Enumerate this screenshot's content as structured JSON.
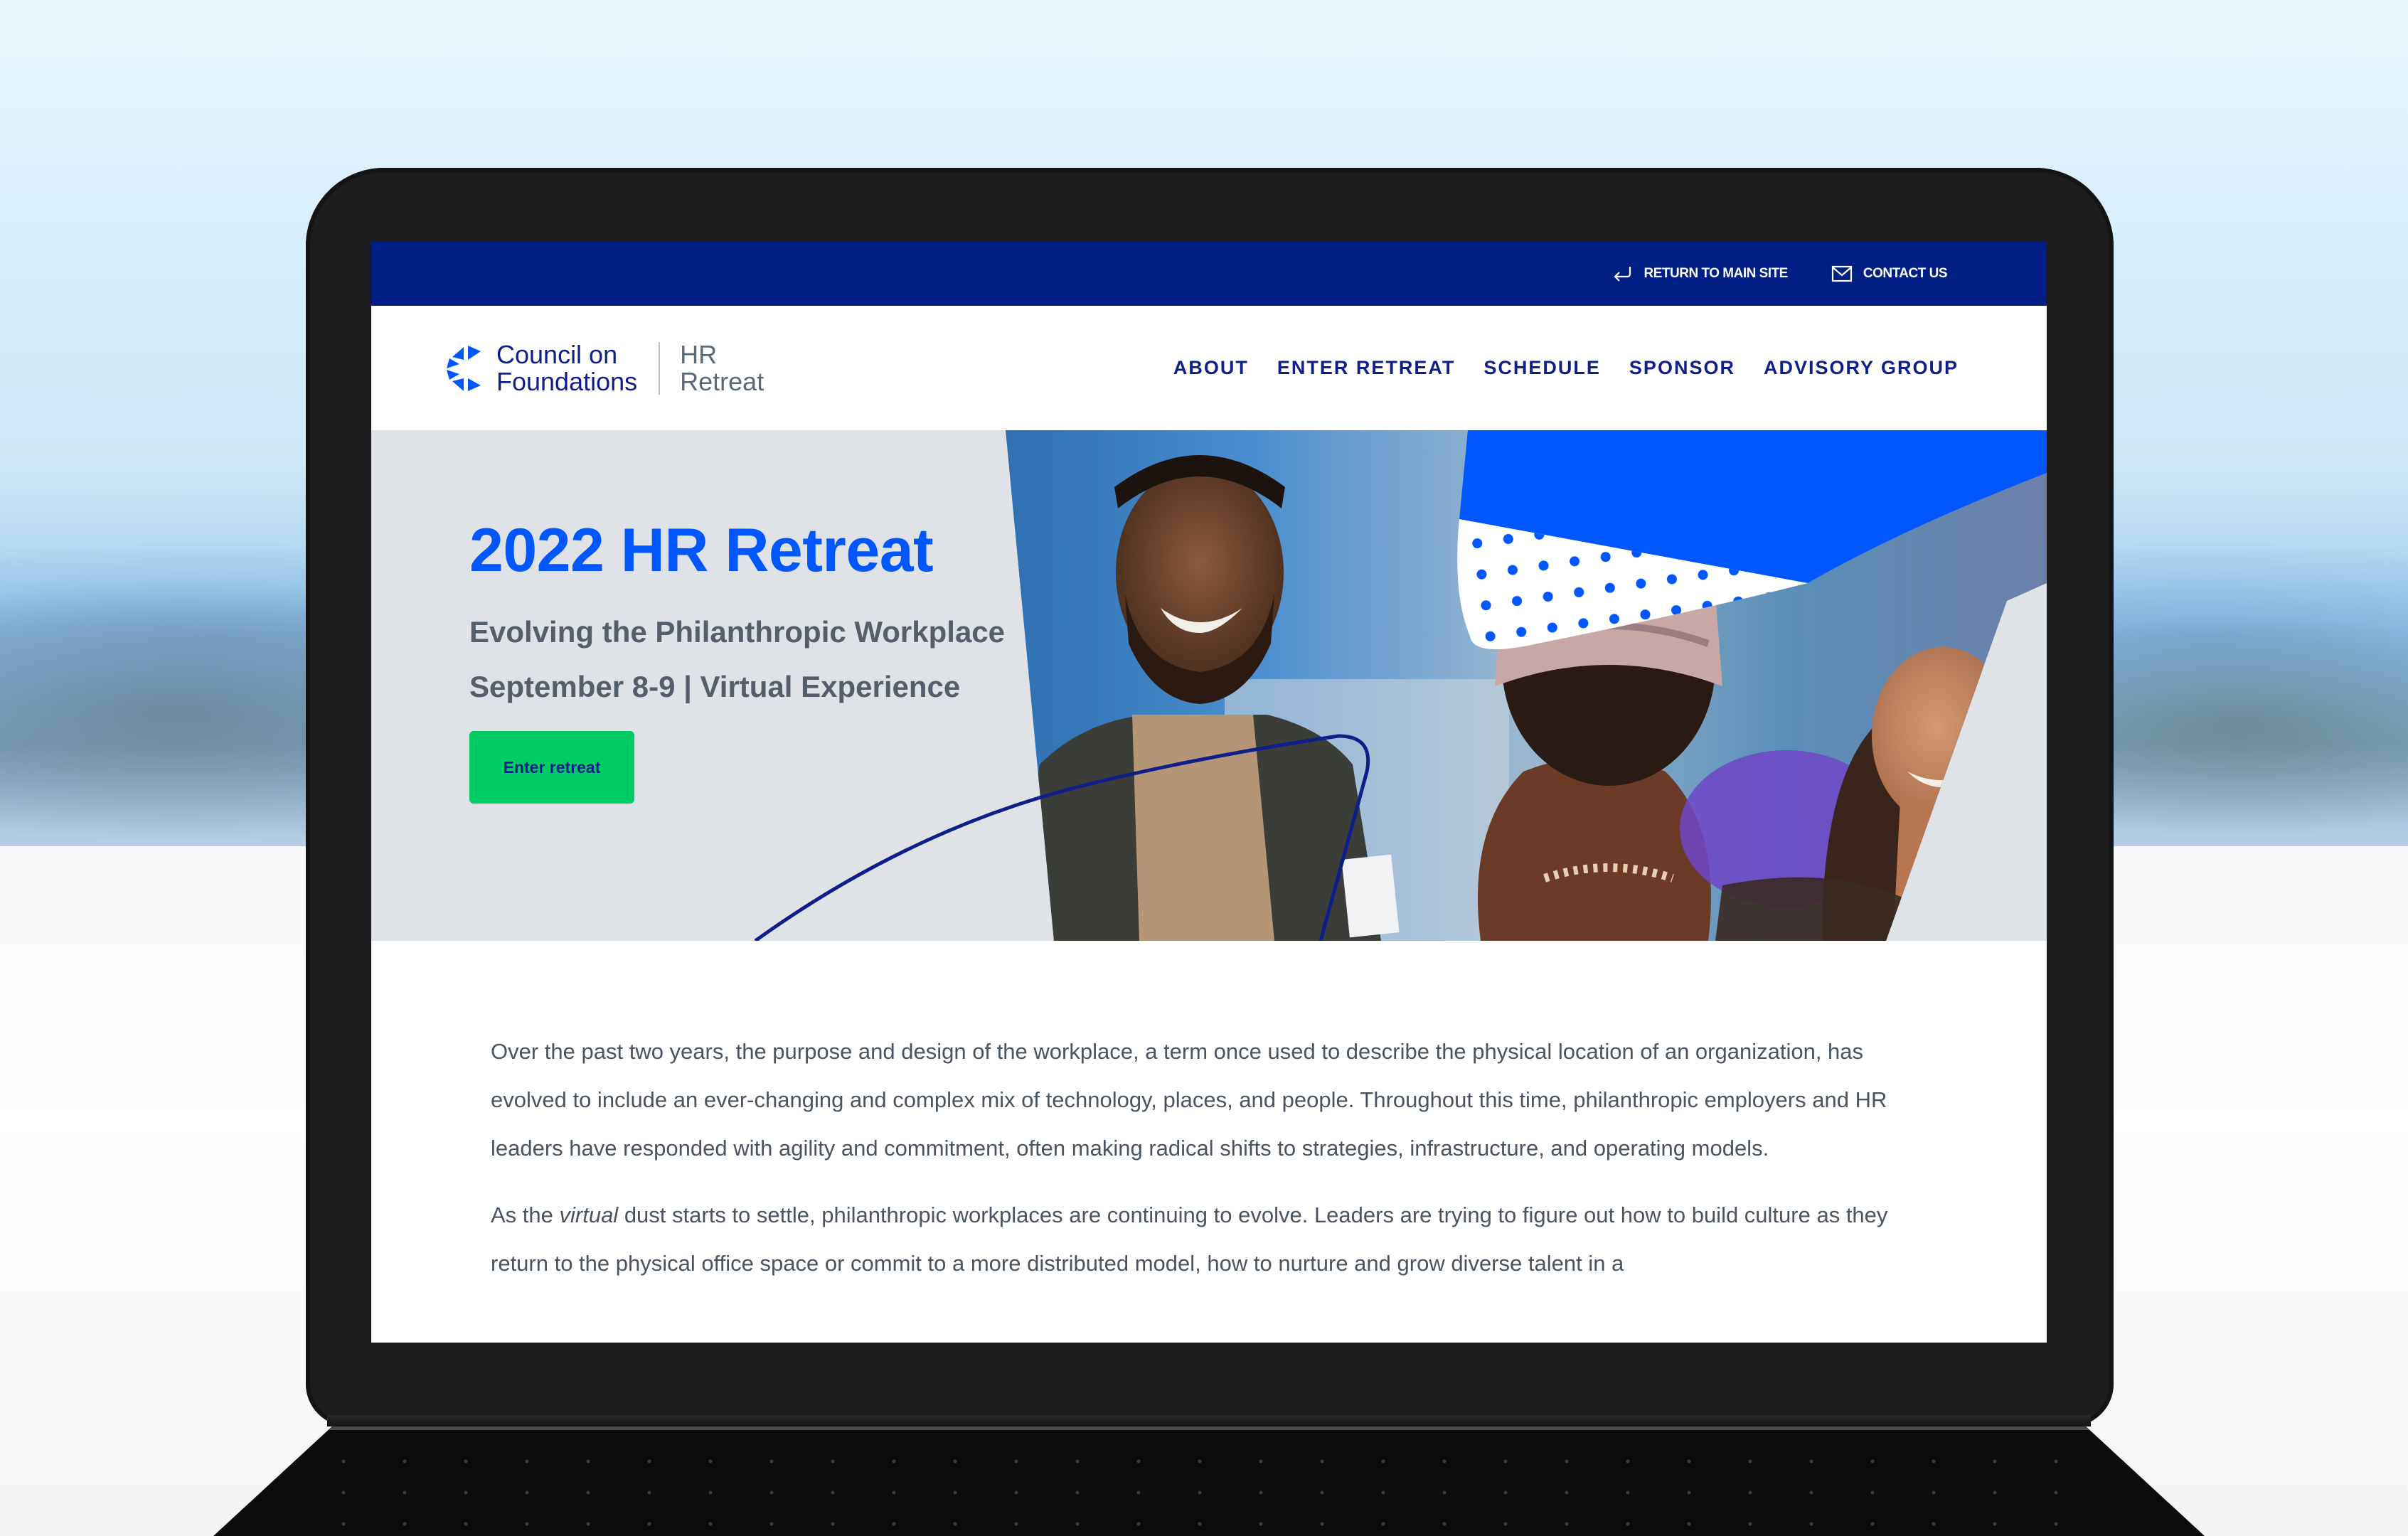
{
  "site": {
    "utility_bar": {
      "links": [
        {
          "label": "RETURN TO MAIN SITE",
          "icon": "return-arrow-icon"
        },
        {
          "label": "CONTACT US",
          "icon": "envelope-icon"
        }
      ]
    },
    "logo": {
      "org_line1": "Council on",
      "org_line2": "Foundations",
      "event_line1": "HR",
      "event_line2": "Retreat"
    },
    "nav": {
      "items": [
        "ABOUT",
        "ENTER RETREAT",
        "SCHEDULE",
        "SPONSOR",
        "ADVISORY GROUP"
      ]
    },
    "hero": {
      "title": "2022 HR Retreat",
      "subtitle": "Evolving the Philanthropic Workplace",
      "date_line": "September 8-9 | Virtual Experience",
      "cta_label": "Enter retreat",
      "image_alt": "Attendees smiling and talking at an event"
    },
    "body": {
      "paragraph1": "Over the past two years, the purpose and design of the workplace, a term once used to describe the physical location of an organization, has evolved to include an ever-changing and complex mix of technology, places, and people. Throughout this time, philanthropic employers and HR leaders have responded with agility and commitment, often making radical shifts to strategies, infrastructure, and operating models.",
      "paragraph2_prefix": "As the ",
      "paragraph2_emphasis": "virtual",
      "paragraph2_rest": " dust starts to settle, philanthropic workplaces are continuing to evolve. Leaders are trying to figure out how to build culture as they return to the physical office space or commit to a more distributed model, how to nurture and grow diverse talent in a"
    },
    "colors": {
      "navy": "#001f85",
      "brand_blue": "#0057ff",
      "cta_green": "#00cc66",
      "hero_gray": "#dfe2e6",
      "text_gray": "#545f6b"
    }
  }
}
